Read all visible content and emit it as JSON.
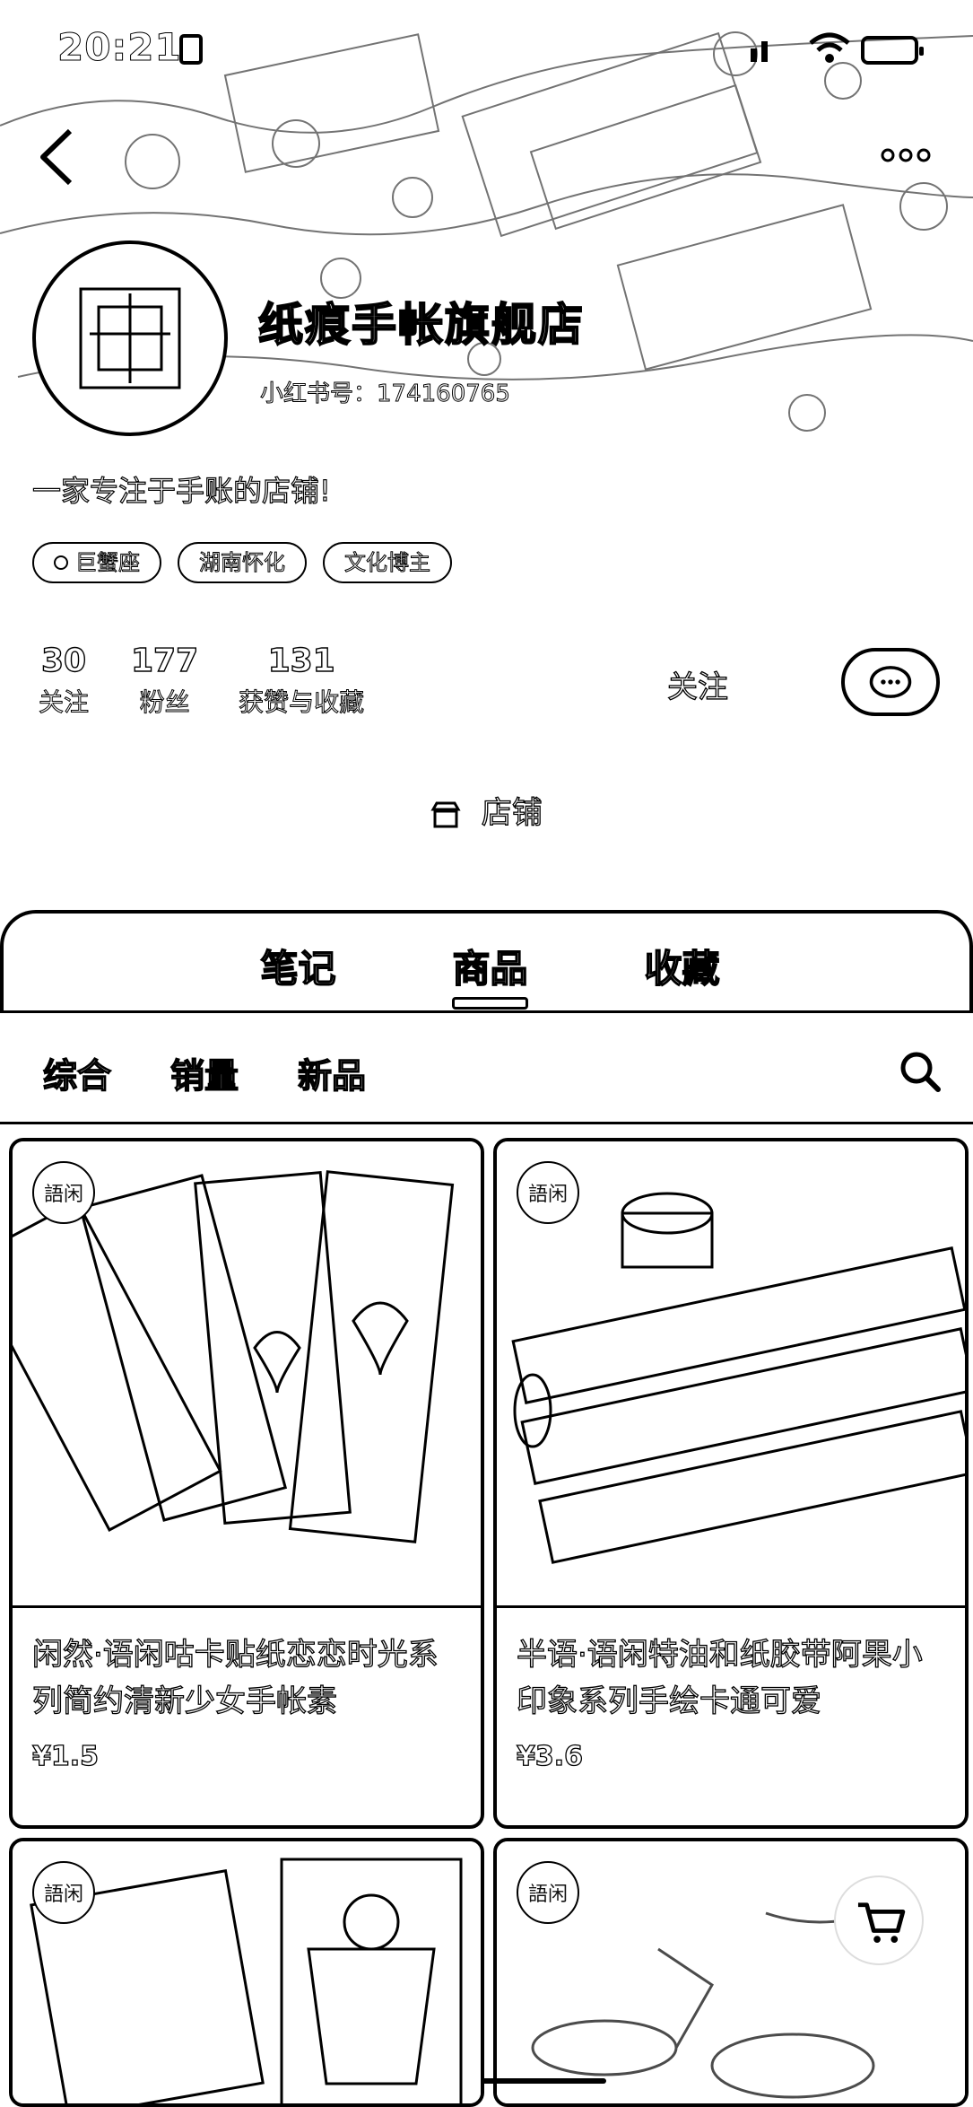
{
  "status_bar": {
    "time": "20:21"
  },
  "profile": {
    "shop_name": "纸痕手帐旗舰店",
    "red_id": "小红书号：174160765",
    "bio": "一家专注于手账的店铺!",
    "tags": [
      "巨蟹座",
      "湖南怀化",
      "文化博主"
    ],
    "stats": [
      {
        "value": "30",
        "label": "关注"
      },
      {
        "value": "177",
        "label": "粉丝"
      },
      {
        "value": "131",
        "label": "获赞与收藏"
      }
    ],
    "follow_label": "关注",
    "shop_link_label": "店铺"
  },
  "tabs": [
    {
      "label": "笔记",
      "active": false
    },
    {
      "label": "商品",
      "active": true
    },
    {
      "label": "收藏",
      "active": false
    }
  ],
  "filters": [
    "综合",
    "销量",
    "新品"
  ],
  "brand_badge": "語闲",
  "products": [
    {
      "title": "闲然·语闲咕卡贴纸恋恋时光系列简约清新少女手帐素",
      "price": "¥1.5"
    },
    {
      "title": "半语·语闲特油和纸胶带阿果小印象系列手绘卡通可爱",
      "price": "¥3.6"
    },
    {
      "title": "",
      "price": ""
    },
    {
      "title": "",
      "price": ""
    }
  ]
}
